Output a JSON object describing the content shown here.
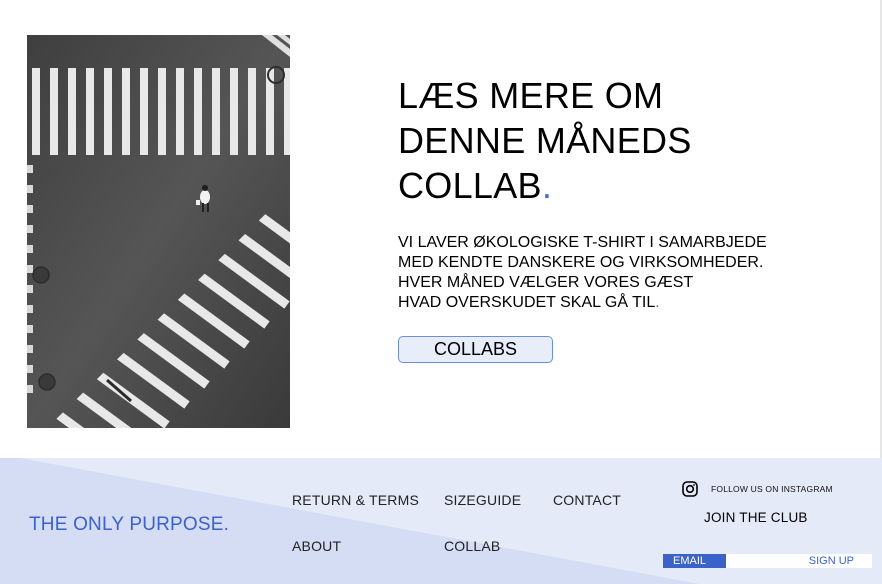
{
  "hero": {
    "title_lines": [
      "LÆS MERE OM",
      "DENNE MÅNEDS",
      "COLLAB"
    ],
    "title_dot": ".",
    "body_lines": [
      "VI LAVER ØKOLOGISKE T-SHIRT I SAMARBJEDE",
      "MED KENDTE DANSKERE OG VIRKSOMHEDER.",
      "HVER MÅNED VÆLGER VORES GÆST",
      "HVAD OVERSKUDET SKAL GÅ TIL"
    ],
    "body_dot": ".",
    "button_label": "COLLABS",
    "accent_color": "#3b6fd6"
  },
  "footer": {
    "brand": "THE ONLY PURPOSE.",
    "links": {
      "return_terms": "RETURN & TERMS",
      "sizeguide": "SIZEGUIDE",
      "contact": "CONTACT",
      "about": "ABOUT",
      "collab": "COLLAB"
    },
    "instagram_icon": "instagram-icon",
    "instagram_label": "FOLLOW US ON INSTAGRAM",
    "join_label": "JOIN THE CLUB",
    "email_placeholder": "EMAIL",
    "signup_label": "SIGN UP",
    "colors": {
      "background": "#e5eaf8",
      "shape": "#d5ddf5",
      "brand": "#3b62c9"
    }
  }
}
